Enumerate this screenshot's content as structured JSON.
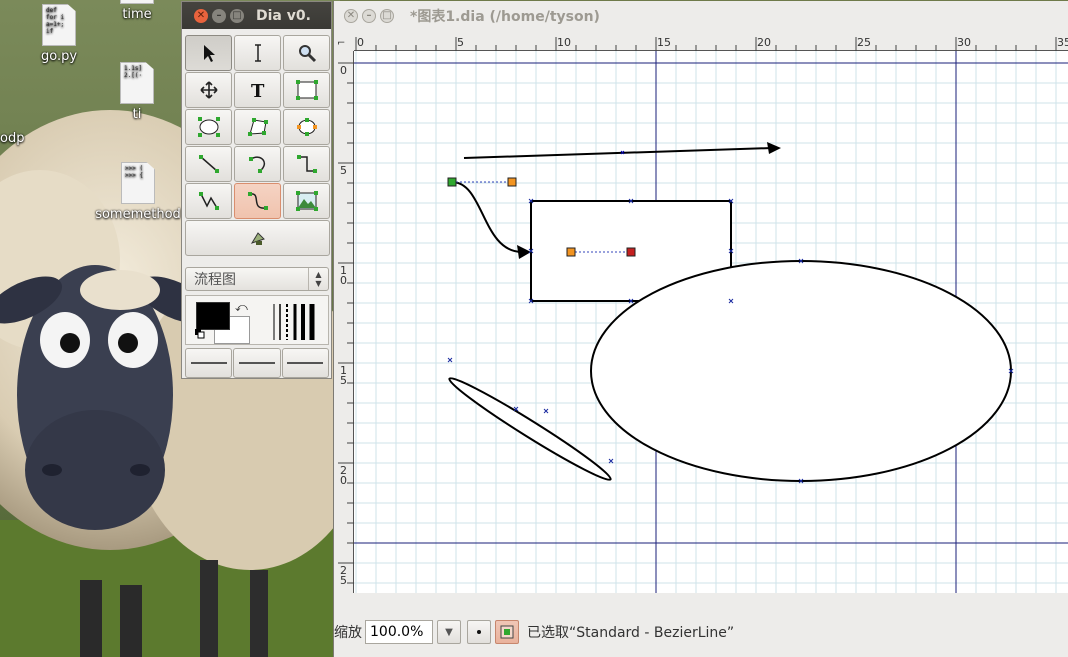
{
  "desktop": {
    "icons": [
      {
        "label": "time",
        "preview": ""
      },
      {
        "label": "go.py",
        "preview": "def \nfor i\na=1+;\nif"
      },
      {
        "label": "ti",
        "preview": "1.1s]\n2.[(·"
      },
      {
        "label": "odp",
        "preview": ""
      },
      {
        "label": "somemethod",
        "preview": ">>> (\n>>> {"
      }
    ]
  },
  "toolbox": {
    "title": "Dia v0.",
    "tools": [
      {
        "name": "modify",
        "icon": "pointer-arrow-icon"
      },
      {
        "name": "text-edit",
        "icon": "i-beam-icon"
      },
      {
        "name": "magnify",
        "icon": "magnifier-icon"
      },
      {
        "name": "scroll",
        "icon": "move-cross-icon"
      },
      {
        "name": "text",
        "icon": "text-t-icon"
      },
      {
        "name": "box",
        "icon": "box-icon"
      },
      {
        "name": "ellipse",
        "icon": "ellipse-icon"
      },
      {
        "name": "polygon",
        "icon": "polygon-icon"
      },
      {
        "name": "beziergon",
        "icon": "beziergon-icon"
      },
      {
        "name": "line",
        "icon": "line-icon"
      },
      {
        "name": "arc",
        "icon": "arc-icon"
      },
      {
        "name": "zigzag",
        "icon": "zigzag-line-icon"
      },
      {
        "name": "polyline",
        "icon": "polyline-icon"
      },
      {
        "name": "bezierline",
        "icon": "bezier-line-icon"
      },
      {
        "name": "image",
        "icon": "image-icon"
      },
      {
        "name": "outline",
        "icon": "outline-icon"
      }
    ],
    "sheet": "流程图"
  },
  "diagram": {
    "title": "*图表1.dia (/home/tyson)",
    "ruler_h": [
      "0",
      "5",
      "10",
      "15",
      "20",
      "25",
      "30",
      "35"
    ],
    "ruler_v": [
      [
        "0"
      ],
      [
        "5"
      ],
      [
        "1",
        "0"
      ],
      [
        "1",
        "5"
      ],
      [
        "2",
        "0"
      ],
      [
        "2",
        "5"
      ]
    ],
    "zoom_label": "缩放",
    "zoom_value": "100.0%",
    "status": "已选取“Standard - BezierLine”"
  },
  "colors": {
    "guide": "#1a1f7a",
    "grid": "#cfe3ea",
    "handle_green": "#2fa82f",
    "handle_orange": "#f29421",
    "handle_red": "#c42020"
  }
}
